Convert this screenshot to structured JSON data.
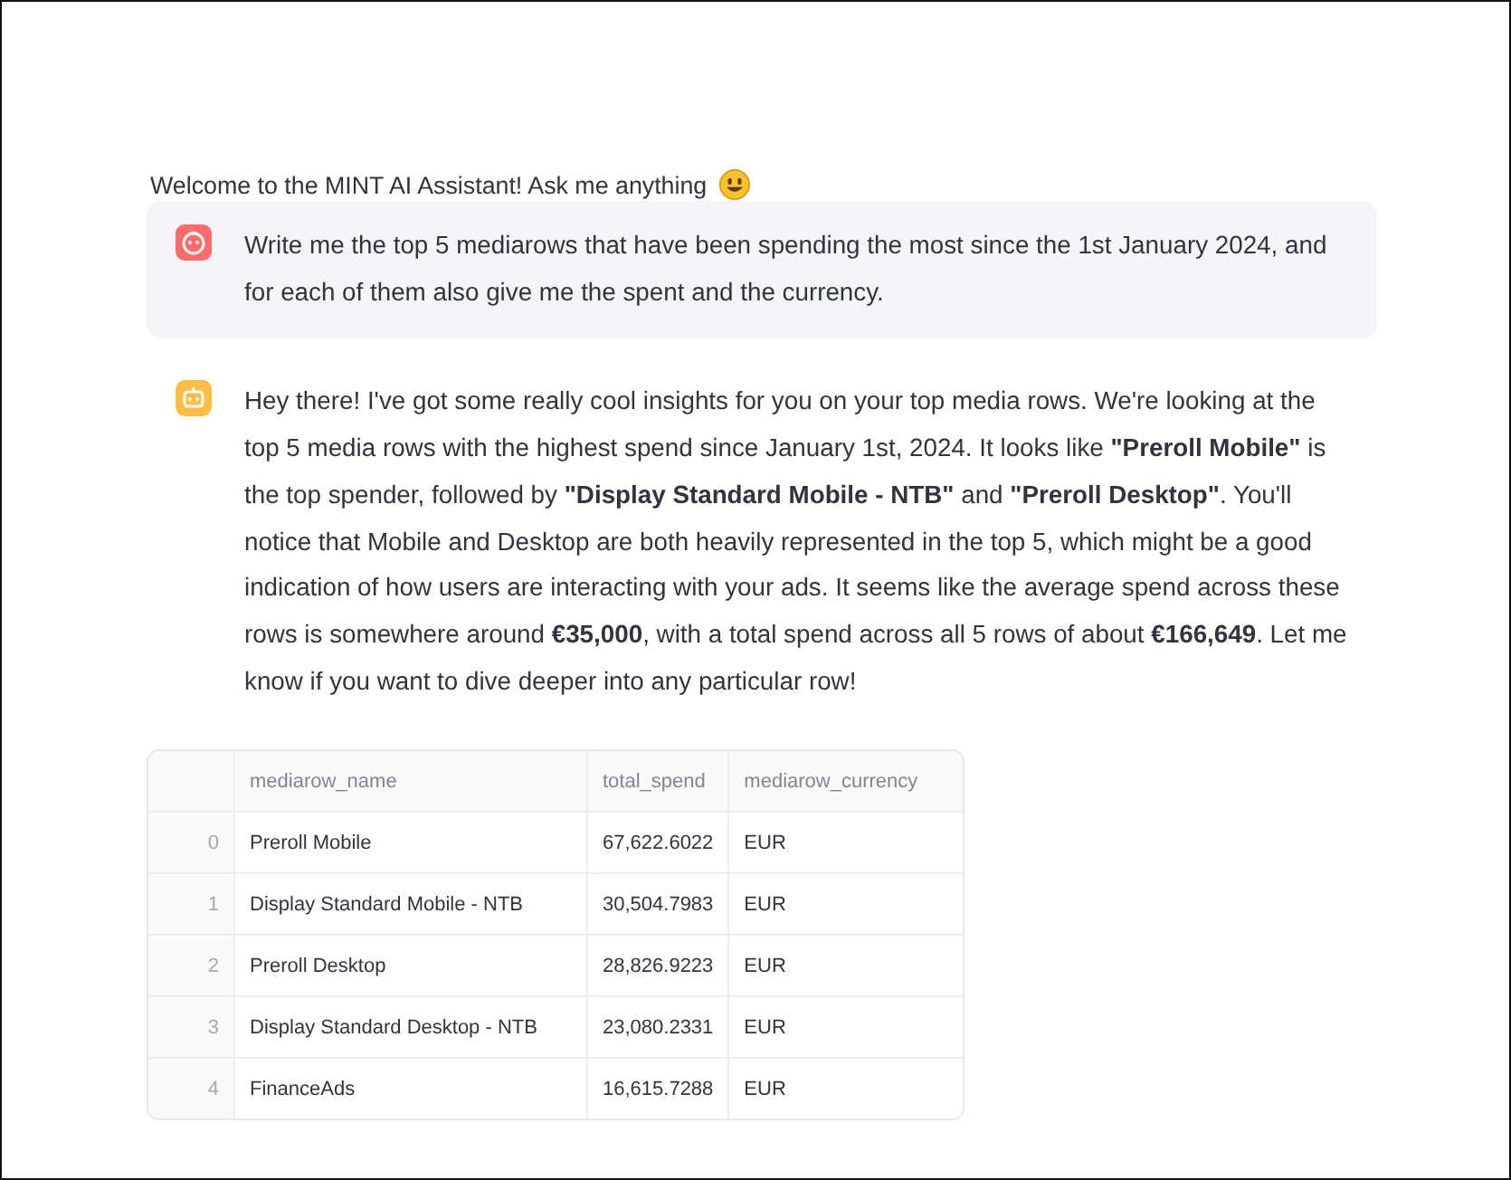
{
  "welcome": {
    "text": "Welcome to the MINT AI Assistant! Ask me anything"
  },
  "messages": [
    {
      "kind": "user",
      "text": "Write me the top 5 mediarows that have been spending the most since the 1st January 2024, and for each of them also give me the spent and the currency."
    },
    {
      "kind": "assistant",
      "text": "Hey there! I've got some really cool insights for you on your top media rows. We're looking at the top 5 media rows with the highest spend since January 1st, 2024. It looks like **\"Preroll Mobile\"** is the top spender, followed by **\"Display Standard Mobile - NTB\"** and **\"Preroll Desktop\"**. You'll notice that Mobile and Desktop are both heavily represented in the top 5, which might be a good indication of how users are interacting with your ads. It seems like the average spend across these rows is somewhere around **€35,000**, with a total spend across all 5 rows of about **€166,649**. Let me know if you want to dive deeper into any particular row!"
    }
  ],
  "table": {
    "columns": [
      "mediarow_name",
      "total_spend",
      "mediarow_currency"
    ],
    "rows": [
      {
        "index": "0",
        "cells": [
          "Preroll Mobile",
          "67,622.6022",
          "EUR"
        ]
      },
      {
        "index": "1",
        "cells": [
          "Display Standard Mobile - NTB",
          "30,504.7983",
          "EUR"
        ]
      },
      {
        "index": "2",
        "cells": [
          "Preroll Desktop",
          "28,826.9223",
          "EUR"
        ]
      },
      {
        "index": "3",
        "cells": [
          "Display Standard Desktop - NTB",
          "23,080.2331",
          "EUR"
        ]
      },
      {
        "index": "4",
        "cells": [
          "FinanceAds",
          "16,615.7288",
          "EUR"
        ]
      }
    ]
  }
}
